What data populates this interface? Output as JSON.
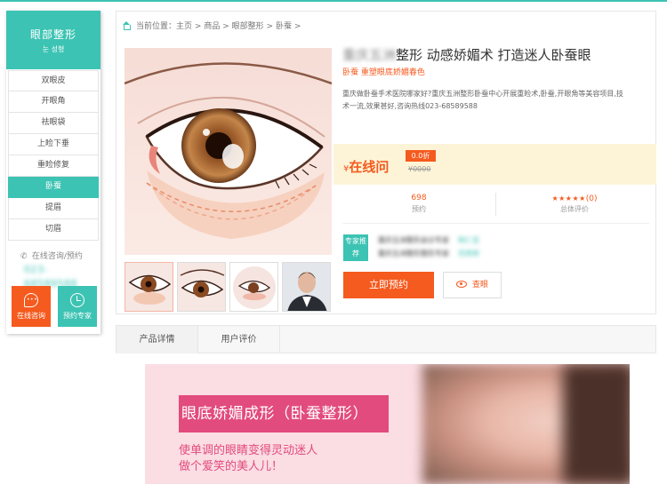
{
  "brand_color": "#3cc3b3",
  "accent_color": "#f55a1e",
  "sidebar": {
    "title": "眼部整形",
    "subtitle": "눈 성형",
    "items": [
      {
        "label": "双眼皮",
        "active": false
      },
      {
        "label": "开眼角",
        "active": false
      },
      {
        "label": "祛眼袋",
        "active": false
      },
      {
        "label": "上睑下垂",
        "active": false
      },
      {
        "label": "重睑修复",
        "active": false
      },
      {
        "label": "卧蚕",
        "active": true
      },
      {
        "label": "提眉",
        "active": false
      },
      {
        "label": "切眉",
        "active": false
      }
    ],
    "phone_label": "在线咨询/预约",
    "phone_number": "023-68589588",
    "btn_consult": "在线咨询",
    "btn_book_expert": "预约专家"
  },
  "breadcrumb": {
    "prefix": "当前位置：",
    "items": [
      "主页",
      "商品",
      "眼部整形",
      "卧蚕"
    ],
    "separator": ">"
  },
  "product": {
    "title_blurred": "重庆五洲",
    "title": "整形 动感娇媚术 打造迷人卧蚕眼",
    "subtitle": "卧蚕 重塑眼底娇媚春色",
    "description": "重庆做卧蚕手术医院哪家好?重庆五洲整形卧蚕中心开展重睑术,卧蚕,开眼角等美容项目,技术一流,效果甚好,咨询热线023-68589588",
    "price_symbol": "¥",
    "price": "在线问",
    "discount": "0.0折",
    "old_price": "¥0000",
    "booked_count": "698",
    "booked_label": "预约",
    "stars": "★★★★★",
    "rating_count": "(0)",
    "rating_label": "总体评价",
    "expert_tag": "专家推荐",
    "experts": [
      {
        "hospital": "重庆五洲整形会诊专家",
        "doctor": "韩仁宝"
      },
      {
        "hospital": "重庆五洲整形整形专家",
        "doctor": "范荣辉"
      }
    ],
    "book_button": "立即预约",
    "view_button": "查眼"
  },
  "tabs": [
    {
      "label": "产品详情"
    },
    {
      "label": "用户评价"
    }
  ],
  "banner": {
    "headline": "眼底娇媚成形（卧蚕整形）",
    "line1": "使单调的眼睛变得灵动迷人",
    "line2": "做个爱笑的美人儿！"
  }
}
